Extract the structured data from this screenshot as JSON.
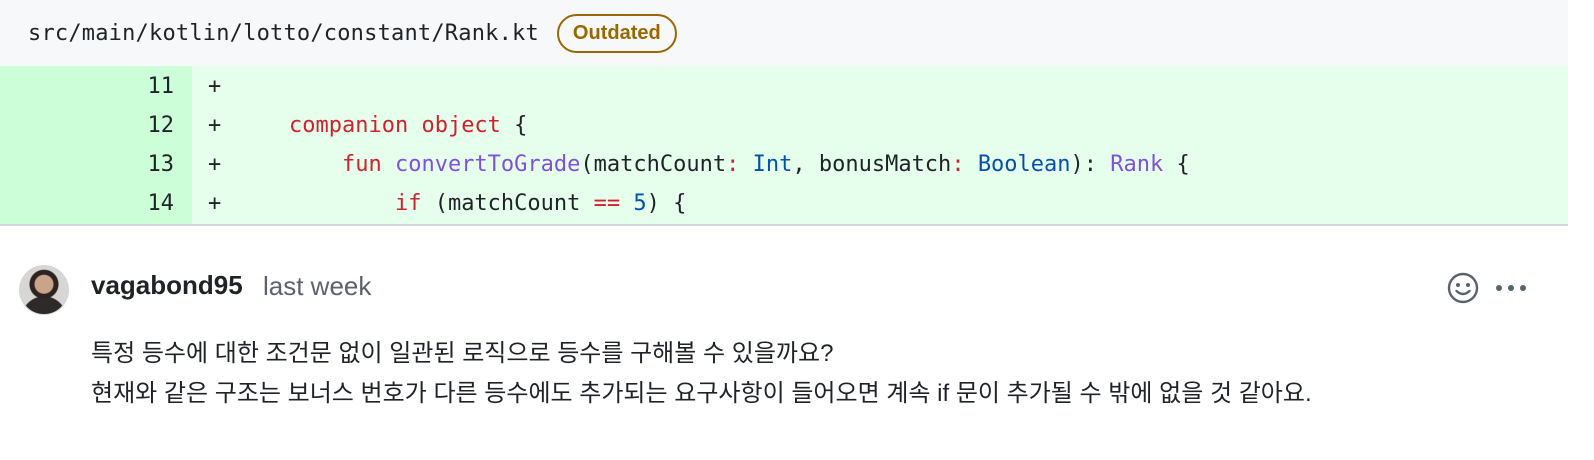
{
  "file": {
    "path": "src/main/kotlin/lotto/constant/Rank.kt",
    "badge": "Outdated"
  },
  "diff": {
    "lines": [
      {
        "number": "11",
        "marker": "+"
      },
      {
        "number": "12",
        "marker": "+"
      },
      {
        "number": "13",
        "marker": "+"
      },
      {
        "number": "14",
        "marker": "+"
      }
    ],
    "code": {
      "l12_kw1": "companion",
      "l12_kw2": "object",
      "l12_rest": " {",
      "l13_kw": "fun",
      "l13_fn": "convertToGrade",
      "l13_p1": "(matchCount",
      "l13_c1": ":",
      "l13_t1": "Int",
      "l13_p2": ", bonusMatch",
      "l13_c2": ":",
      "l13_t2": "Boolean",
      "l13_p3": "): ",
      "l13_rk": "Rank",
      "l13_end": " {",
      "l14_kw": "if",
      "l14_p1": " (matchCount ",
      "l14_op": "==",
      "l14_num": "5",
      "l14_end": ") {"
    }
  },
  "comment": {
    "author": "vagabond95",
    "time": "last week",
    "body": [
      "특정 등수에 대한 조건문 없이 일관된 로직으로 등수를 구해볼 수 있을까요?",
      "현재와 같은 구조는 보너스 번호가 다른 등수에도 추가되는 요구사항이 들어오면 계속 if 문이 추가될 수 밖에 없을 것 같아요."
    ],
    "icons": {
      "reaction": "smiley-icon",
      "menu": "kebab-horizontal-icon"
    }
  },
  "colors": {
    "diff_bg": "#e6ffec",
    "gutter_bg": "#ccffd8",
    "badge": "#9a6700",
    "keyword": "#cf222e",
    "function": "#8250df",
    "type": "#0550ae"
  }
}
